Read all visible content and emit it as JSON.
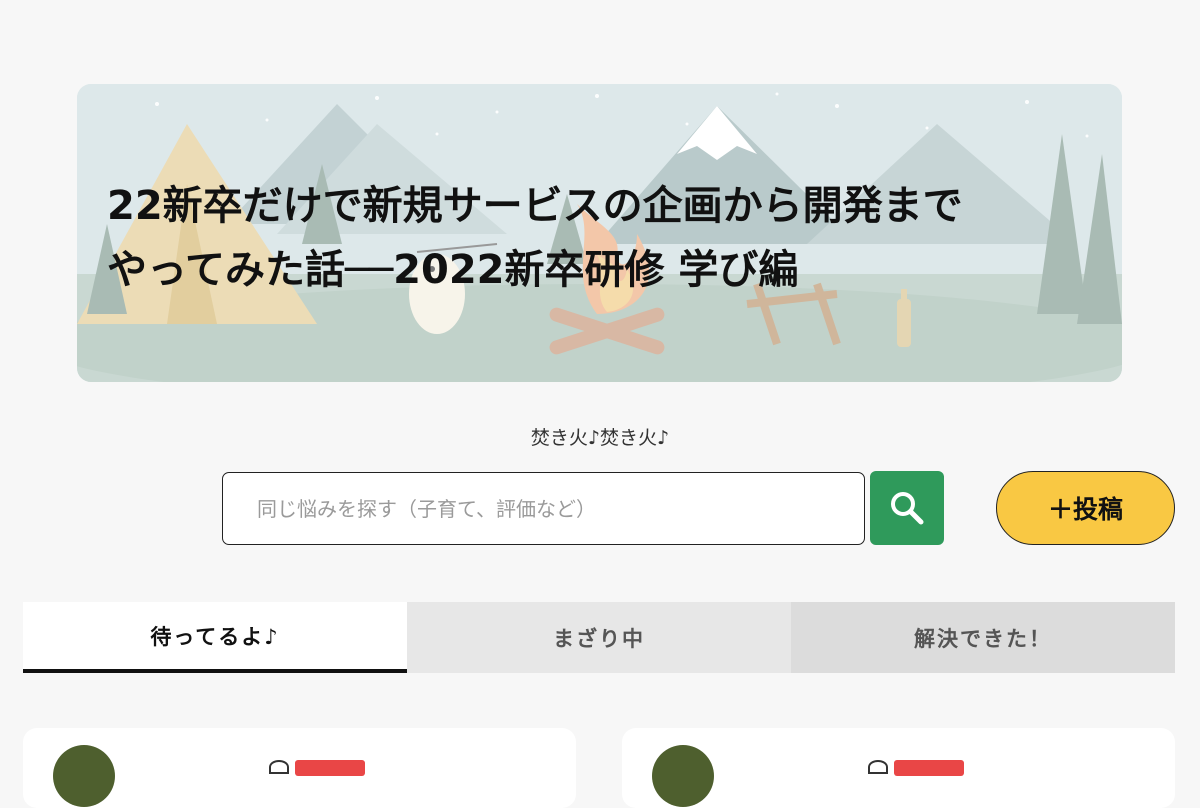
{
  "hero": {
    "title_line1": "22新卒だけで新規サービスの企画から開発まで",
    "title_line2": "やってみた話──2022新卒研修 学び編"
  },
  "tagline": "焚き火♪焚き火♪",
  "search": {
    "placeholder": "同じ悩みを探す（子育て、評価など）",
    "value": ""
  },
  "post_button_label": "＋投稿",
  "tabs": [
    {
      "label": "待ってるよ♪"
    },
    {
      "label": "まざり中"
    },
    {
      "label": "解決できた！"
    }
  ],
  "colors": {
    "accent_green": "#2f9a5b",
    "post_yellow": "#f9c843",
    "badge_red": "#e94646",
    "avatar_olive": "#4e5f2e"
  },
  "icons": {
    "search": "search-icon",
    "post": "plus-icon"
  }
}
